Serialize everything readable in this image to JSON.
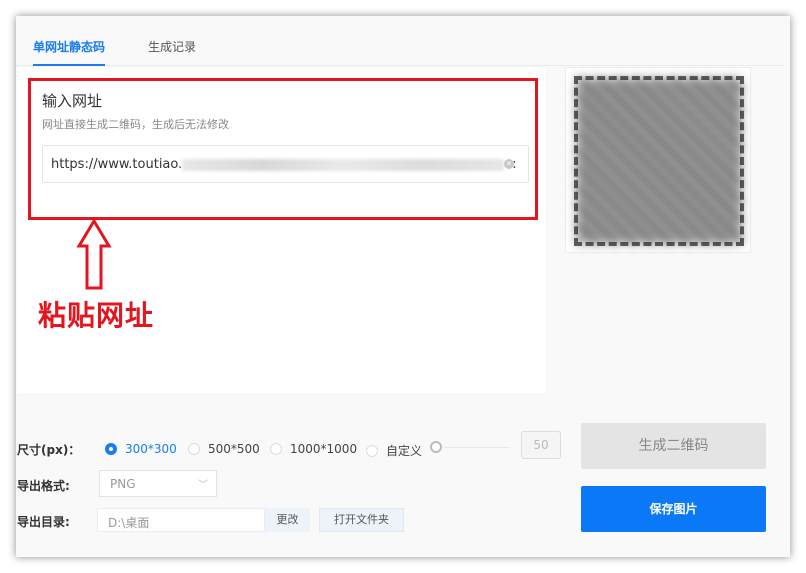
{
  "tabs": [
    {
      "label": "单网址静态码",
      "active": true
    },
    {
      "label": "生成记录",
      "active": false
    }
  ],
  "input_section": {
    "title": "输入网址",
    "subtitle": "网址直接生成二维码，生成后无法修改",
    "url_prefix": "https://www.toutiao.",
    "url_suffix": "e:"
  },
  "annotation": {
    "text": "粘贴网址",
    "color": "#e3161f"
  },
  "size": {
    "label": "尺寸(px)：",
    "options": [
      "300*300",
      "500*500",
      "1000*1000",
      "自定义"
    ],
    "selected": "300*300",
    "custom_value": "50"
  },
  "format": {
    "label": "导出格式:",
    "value": "PNG"
  },
  "directory": {
    "label": "导出目录:",
    "value": "D:\\桌面",
    "change_label": "更改",
    "open_folder_label": "打开文件夹"
  },
  "buttons": {
    "generate": "生成二维码",
    "save": "保存图片"
  },
  "colors": {
    "accent": "#1a7cf0",
    "primary_button": "#0b79f7"
  }
}
